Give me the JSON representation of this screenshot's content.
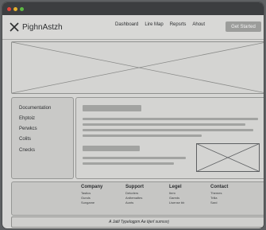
{
  "window": {
    "controls": [
      "close",
      "minimize",
      "maximize"
    ],
    "colors": {
      "close": "#e0443b",
      "minimize": "#e6b22e",
      "maximize": "#5cb944"
    }
  },
  "header": {
    "logo_icon": "x-mark-icon",
    "logo_text": "PighnAstzh",
    "nav": [
      "Dashboard",
      "Lire Map",
      "Repsrts",
      "Ahout"
    ],
    "cta_label": "Get Started"
  },
  "hero": {
    "placeholder": "image-placeholder"
  },
  "sidebar": {
    "items": [
      "Documentation",
      "Ehptoiz",
      "Perwkcs",
      "Colits",
      "Cnecks"
    ]
  },
  "main": {
    "image_placeholder": "image-placeholder"
  },
  "footer": {
    "columns": [
      {
        "heading": "Company",
        "links": [
          "Tastics",
          "Gunds",
          "Sungame"
        ]
      },
      {
        "heading": "Support",
        "links": [
          "Detorlers",
          "Ardtemaltes",
          "Aunts"
        ]
      },
      {
        "heading": "Legel",
        "links": [
          "Item",
          "Gareds",
          "Lisense bb"
        ]
      },
      {
        "heading": "Contact",
        "links": [
          "Themes",
          "Trilla",
          "Sard"
        ]
      }
    ]
  },
  "status": {
    "text": "A Jatil Typelogpm Ae tijerl sumssrj"
  }
}
